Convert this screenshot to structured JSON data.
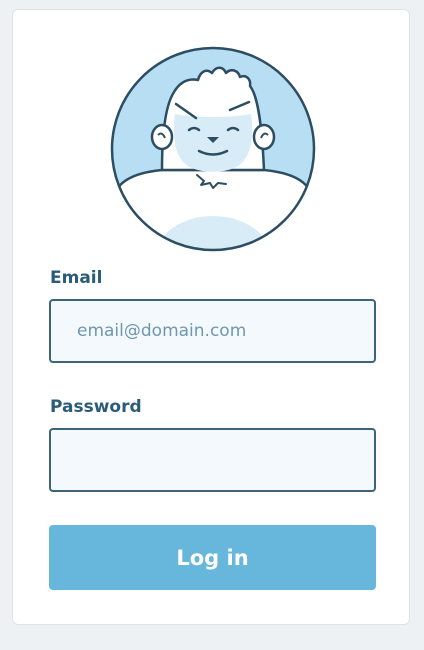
{
  "form": {
    "email_label": "Email",
    "email_placeholder": "email@domain.com",
    "email_value": "",
    "password_label": "Password",
    "password_value": "",
    "login_label": "Log in"
  },
  "avatar": {
    "icon": "yeti-avatar-icon"
  },
  "colors": {
    "page_background": "#eef1f3",
    "card_background": "#ffffff",
    "label_text": "#2b5c7a",
    "input_border": "#3c6579",
    "input_background": "#f4f9fd",
    "placeholder_text": "#6f97b0",
    "button_background": "#67b6db",
    "button_text": "#ffffff",
    "avatar_background": "#b7def2",
    "avatar_outline": "#2c4d62"
  }
}
